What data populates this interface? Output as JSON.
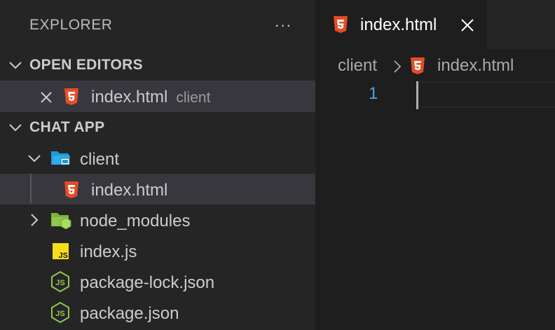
{
  "explorer": {
    "title": "EXPLORER",
    "more_actions": "···"
  },
  "open_editors": {
    "header": "OPEN EDITORS",
    "items": [
      {
        "name": "index.html",
        "folder": "client",
        "icon": "html5-icon"
      }
    ]
  },
  "project": {
    "header": "CHAT APP",
    "tree": [
      {
        "name": "client",
        "icon": "folder-client-icon",
        "expanded": true
      },
      {
        "name": "index.html",
        "icon": "html5-icon",
        "selected": true
      },
      {
        "name": "node_modules",
        "icon": "folder-node-icon",
        "expanded": false
      },
      {
        "name": "index.js",
        "icon": "js-icon"
      },
      {
        "name": "package-lock.json",
        "icon": "nodejs-icon"
      },
      {
        "name": "package.json",
        "icon": "nodejs-icon"
      }
    ]
  },
  "editor": {
    "tab": {
      "label": "index.html",
      "icon": "html5-icon"
    },
    "breadcrumb": [
      "client",
      "index.html"
    ],
    "line_numbers": [
      "1"
    ]
  },
  "colors": {
    "html5": "#e44d26",
    "js_badge": "#f5de19",
    "nodejs": "#8cc84b",
    "folder_blue": "#1e9bd7",
    "line_number": "#4fa3d9"
  }
}
